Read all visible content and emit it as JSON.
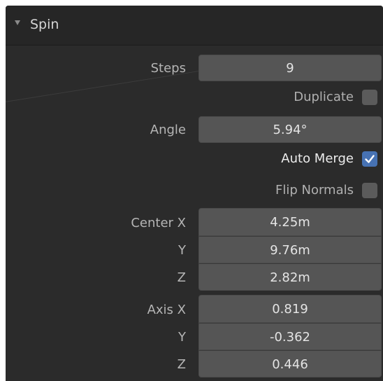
{
  "panel": {
    "title": "Spin",
    "disclosure": "triangle-down-icon"
  },
  "steps": {
    "label": "Steps",
    "value": "9"
  },
  "duplicate": {
    "label": "Duplicate",
    "checked": false
  },
  "angle": {
    "label": "Angle",
    "value": "5.94°"
  },
  "auto_merge": {
    "label": "Auto Merge",
    "checked": true
  },
  "flip_normals": {
    "label": "Flip Normals",
    "checked": false
  },
  "center": {
    "x_label": "Center X",
    "x": "4.25m",
    "y_label": "Y",
    "y": "9.76m",
    "z_label": "Z",
    "z": "2.82m"
  },
  "axis": {
    "x_label": "Axis X",
    "x": "0.819",
    "y_label": "Y",
    "y": "-0.362",
    "z_label": "Z",
    "z": "0.446"
  },
  "colors": {
    "panel_bg": "#2b2b2b",
    "field_bg": "#555555",
    "accent": "#4772b3"
  }
}
